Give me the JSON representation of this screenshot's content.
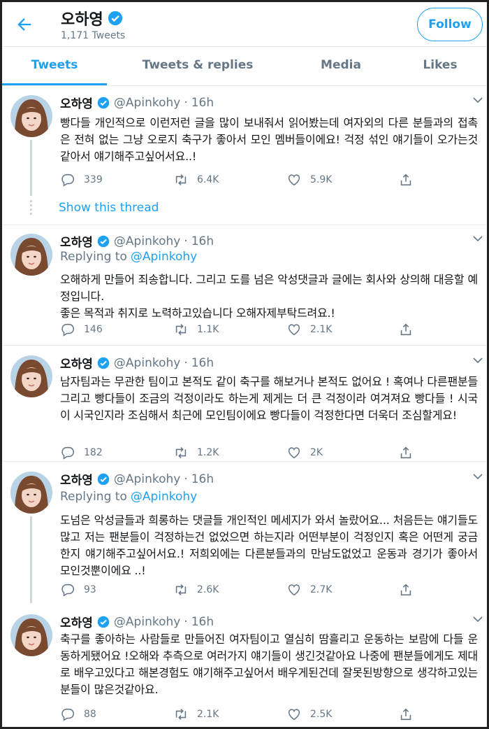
{
  "header": {
    "name": "오하영",
    "tweet_count": "1,171 Tweets",
    "follow_label": "Follow"
  },
  "tabs": [
    "Tweets",
    "Tweets & replies",
    "Media",
    "Likes"
  ],
  "show_thread": "Show this thread",
  "tweets": [
    {
      "name": "오하영",
      "handle": "@Apinkohy",
      "time": "16h",
      "replying_to": "",
      "text": "빵다들 개인적으로 이런저런 글을 많이 보내줘서 읽어봤는데 여자외의 다른 분들과의 접촉은 전혀 없는 그냥 오로지 축구가 좋아서 모인 멤버들이에요! 걱정 섞인 얘기들이 오가는것같아서 얘기해주고싶어서요..!",
      "replies": "339",
      "retweets": "6.4K",
      "likes": "5.9K"
    },
    {
      "name": "오하영",
      "handle": "@Apinkohy",
      "time": "16h",
      "replying_label": "Replying to",
      "replying_to": "@Apinkohy",
      "text": "오해하게 만들어 죄송합니다. 그리고 도를 넘은 악성댓글과 글에는 회사와 상의해 대응할 예정입니다.\n좋은 목적과 취지로 노력하고있습니다 오해자제부탁드려요.!",
      "replies": "146",
      "retweets": "1.1K",
      "likes": "2.1K"
    },
    {
      "name": "오하영",
      "handle": "@Apinkohy",
      "time": "16h",
      "replying_to": "",
      "text": "남자팀과는 무관한 팀이고 본적도 같이 축구를 해보거나 본적도 없어요 ! 혹여나 다른팬분들 그리고 빵다들이 조금의 걱정이라도 하는게 제게는 더 큰 걱정이라 여겨져요 빵다들 ! 시국이 시국인지라 조심해서 최근에 모인팀이에요 빵다들이 걱정한다면 더욱더 조심할게요!",
      "replies": "182",
      "retweets": "1.2K",
      "likes": "2K"
    },
    {
      "name": "오하영",
      "handle": "@Apinkohy",
      "time": "16h",
      "replying_label": "Replying to",
      "replying_to": "@Apinkohy",
      "text": "도넘은 악성글들과 희롱하는 댓글들 개인적인 메세지가 와서 놀랐어요... 처음든는 얘기들도 많고 저는 팬분들이 걱정하는건 없었으면 하는지라 어떤부분이 걱정인지 혹은 어떤게 궁금한지 얘기해주고싶어서요.! 저희외에는 다른분들과의 만남도없었고 운동과 경기가 좋아서 모인것뿐이에요 ..!",
      "replies": "93",
      "retweets": "2.6K",
      "likes": "2.7K"
    },
    {
      "name": "오하영",
      "handle": "@Apinkohy",
      "time": "16h",
      "replying_to": "",
      "text": "축구를 좋아하는 사람들로 만들어진 여자팀이고 열심히 땀흘리고 운동하는 보람에 다들 운동하게됐어요 !오해와 추측으로 여러가지 얘기들이 생긴것같아요 나중에 팬분들에게도 제대로 배우고있다고 해본경험도 얘기해주고싶어서 배우게된건데 잘못된방향으로 생각하고있는 분들이 많은것같아요.",
      "replies": "88",
      "retweets": "2.1K",
      "likes": "2.5K"
    }
  ]
}
